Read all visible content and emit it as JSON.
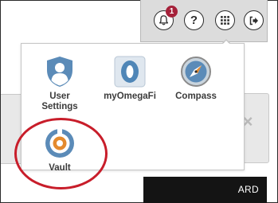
{
  "toolbar": {
    "notification_count": "1",
    "help_label": "?",
    "icons": [
      "bell-icon",
      "help-icon",
      "apps-grid-icon",
      "logout-icon"
    ]
  },
  "apps": [
    {
      "label": "User\nSettings",
      "icon": "user-shield-icon"
    },
    {
      "label": "myOmegaFi",
      "icon": "omega-logo-icon"
    },
    {
      "label": "Compass",
      "icon": "compass-icon"
    },
    {
      "label": "Vault",
      "icon": "vault-icon"
    }
  ],
  "background": {
    "close_label": "×",
    "button_label_fragment": "ARD"
  },
  "colors": {
    "badge": "#a5213a",
    "highlight_ring": "#c81d2a",
    "icon_blue": "#5b8bb8",
    "icon_orange": "#e48a2e",
    "toolbar_bg": "#dcdcdc"
  }
}
